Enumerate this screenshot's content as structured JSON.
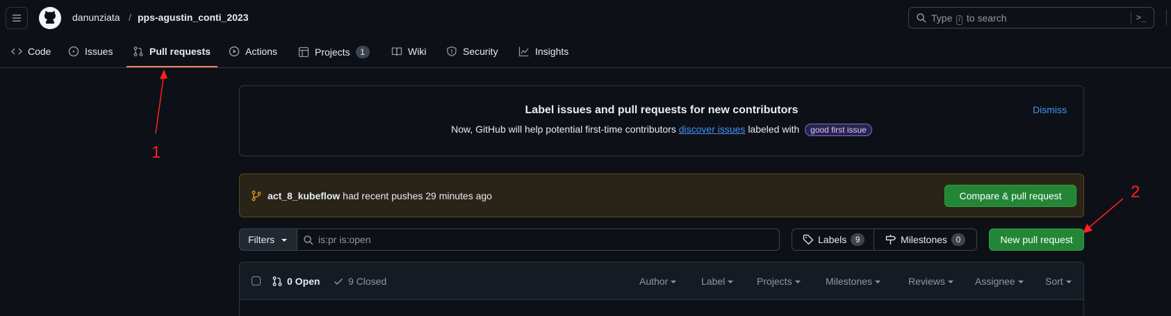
{
  "header": {
    "owner": "danunziata",
    "separator": "/",
    "repo": "pps-agustin_conti_2023",
    "search": {
      "prefix": "Type",
      "key": "/",
      "suffix": "to search",
      "terminal_icon": ">_"
    }
  },
  "tabs": [
    {
      "label": "Code",
      "icon": "code-icon"
    },
    {
      "label": "Issues",
      "icon": "issue-icon"
    },
    {
      "label": "Pull requests",
      "icon": "pull-request-icon",
      "active": true
    },
    {
      "label": "Actions",
      "icon": "play-icon"
    },
    {
      "label": "Projects",
      "icon": "table-icon",
      "count": "1"
    },
    {
      "label": "Wiki",
      "icon": "book-icon"
    },
    {
      "label": "Security",
      "icon": "shield-icon"
    },
    {
      "label": "Insights",
      "icon": "graph-icon"
    }
  ],
  "banner": {
    "title": "Label issues and pull requests for new contributors",
    "body_prefix": "Now, GitHub will help potential first-time contributors",
    "link": "discover issues",
    "body_suffix": "labeled with",
    "label": "good first issue",
    "dismiss": "Dismiss"
  },
  "push_notice": {
    "branch": "act_8_kubeflow",
    "text": "had recent pushes 29 minutes ago",
    "button": "Compare & pull request"
  },
  "toolbar": {
    "filters": "Filters",
    "query": "is:pr is:open",
    "labels": "Labels",
    "labels_count": "9",
    "milestones": "Milestones",
    "milestones_count": "0",
    "new_pr": "New pull request"
  },
  "list": {
    "open": "0 Open",
    "closed": "9 Closed",
    "sorters": [
      "Author",
      "Label",
      "Projects",
      "Milestones",
      "Reviews",
      "Assignee",
      "Sort"
    ]
  },
  "annotations": {
    "one": "1",
    "two": "2"
  },
  "colors": {
    "accent_tab": "#f78166",
    "link": "#4493f8",
    "green": "#238636",
    "annotation": "#ff2020"
  }
}
